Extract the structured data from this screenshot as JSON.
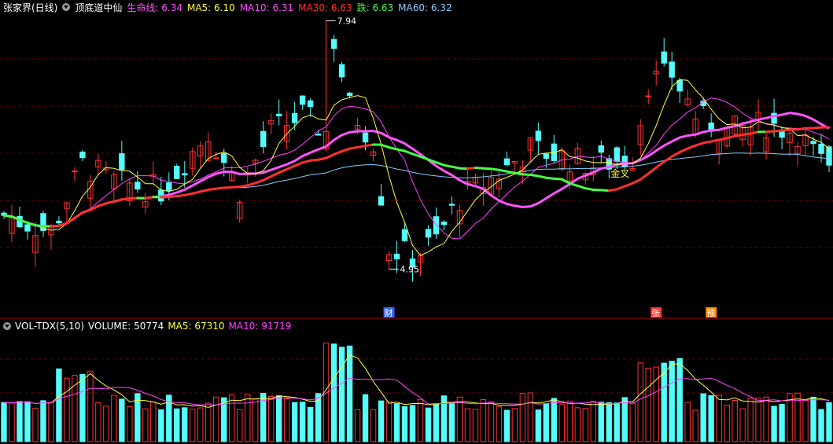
{
  "header": {
    "stock_name": "张家界(日线)",
    "indicator_name": "顶底道中仙",
    "items": [
      {
        "label": "生命线: ",
        "value": "6.34",
        "color": "#ff55ff"
      },
      {
        "label": "MA5: ",
        "value": "6.10",
        "color": "#ffff44"
      },
      {
        "label": "MA10: ",
        "value": "6.31",
        "color": "#ff44ff"
      },
      {
        "label": "MA30: ",
        "value": "6.63",
        "color": "#ff3030"
      },
      {
        "label": "跌: ",
        "value": "6.63",
        "color": "#44ff44"
      },
      {
        "label": "MA60: ",
        "value": "6.32",
        "color": "#88ccff"
      }
    ]
  },
  "volume_header": {
    "name": "VOL-TDX(5,10)",
    "volume": "VOLUME: 50774",
    "ma5": "MA5: 67310",
    "ma10": "MA10: 91719",
    "ma5_color": "#ffff44",
    "ma10_color": "#ff44ff"
  },
  "chart_data": {
    "type": "candlestick",
    "price_range": [
      4.5,
      8.0
    ],
    "high_label": "7.94",
    "low_label": "4.95",
    "markers": [
      "财",
      "张",
      "预"
    ],
    "cross_label": "金叉",
    "up_color": "#ff3333",
    "down_color": "#54fcfc",
    "volume_max": 160000
  }
}
